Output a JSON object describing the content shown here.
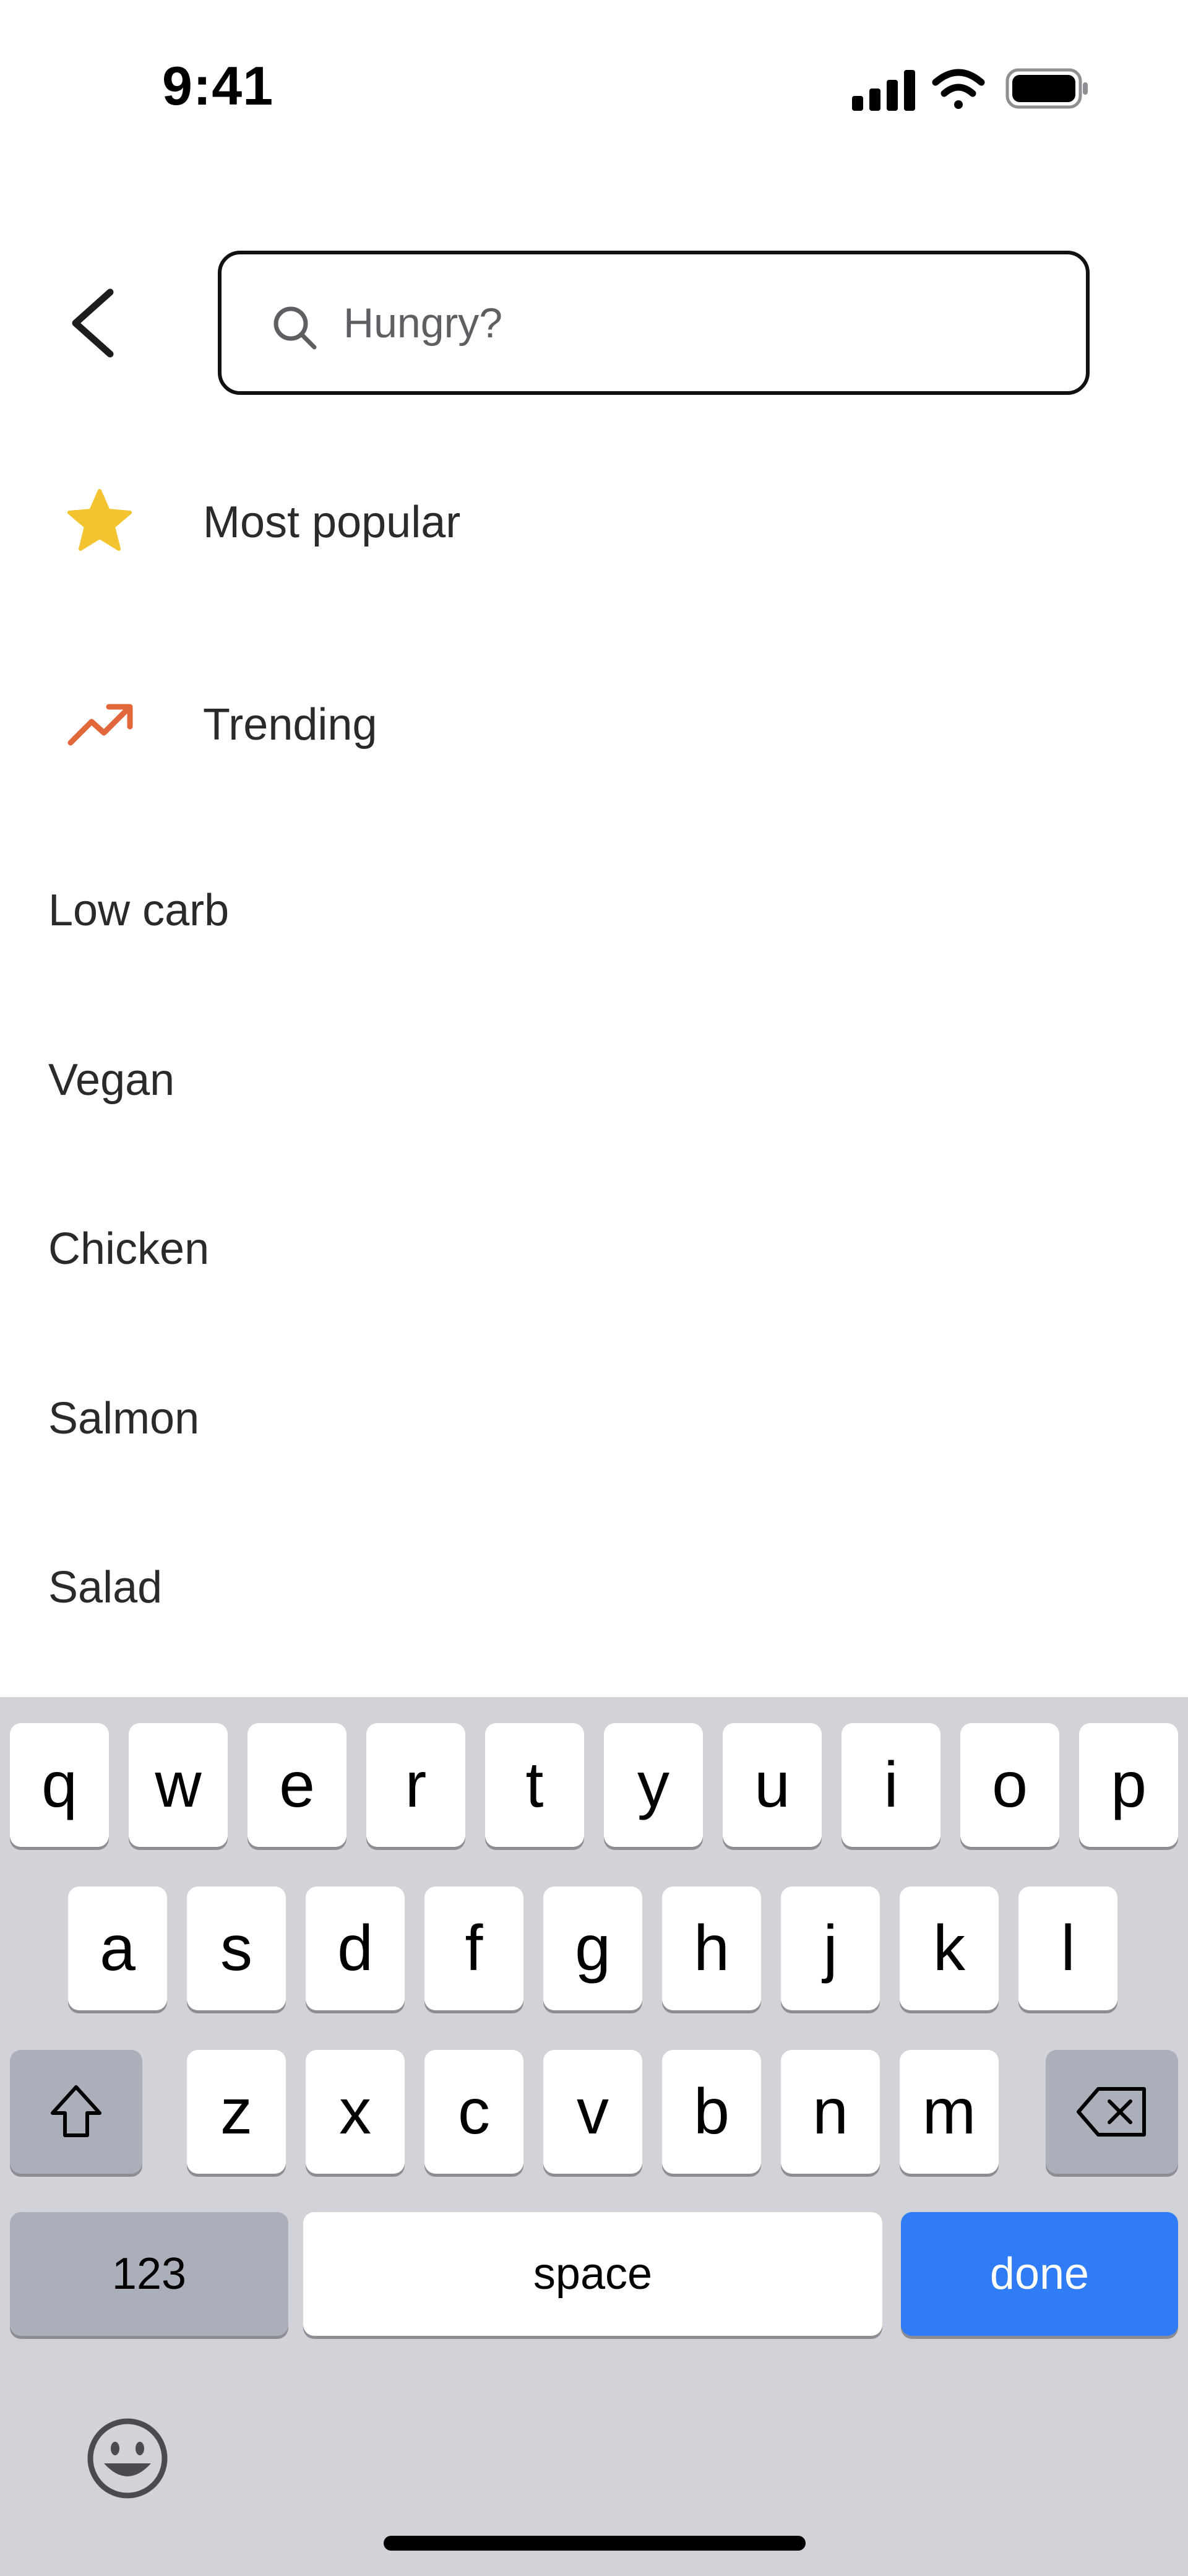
{
  "status_bar": {
    "time": "9:41",
    "icons": [
      "cellular-signal-icon",
      "wifi-icon",
      "battery-icon"
    ]
  },
  "header": {
    "back_icon": "chevron-left-icon",
    "search": {
      "placeholder": "Hungry?",
      "value": "",
      "icon": "search-icon"
    }
  },
  "suggestions": [
    {
      "label": "Most popular",
      "icon": "star-icon",
      "icon_color": "#F4C430"
    },
    {
      "label": "Trending",
      "icon": "trending-up-icon",
      "icon_color": "#E2673A"
    },
    {
      "label": "Low carb"
    },
    {
      "label": "Vegan"
    },
    {
      "label": "Chicken"
    },
    {
      "label": "Salmon"
    },
    {
      "label": "Salad"
    }
  ],
  "keyboard": {
    "row1": [
      "q",
      "w",
      "e",
      "r",
      "t",
      "y",
      "u",
      "i",
      "o",
      "p"
    ],
    "row2": [
      "a",
      "s",
      "d",
      "f",
      "g",
      "h",
      "j",
      "k",
      "l"
    ],
    "row3": [
      "z",
      "x",
      "c",
      "v",
      "b",
      "n",
      "m"
    ],
    "shift_icon": "shift-icon",
    "delete_icon": "backspace-icon",
    "numbers_label": "123",
    "space_label": "space",
    "done_label": "done",
    "emoji_icon": "emoji-icon",
    "done_color": "#2F7CF6"
  }
}
